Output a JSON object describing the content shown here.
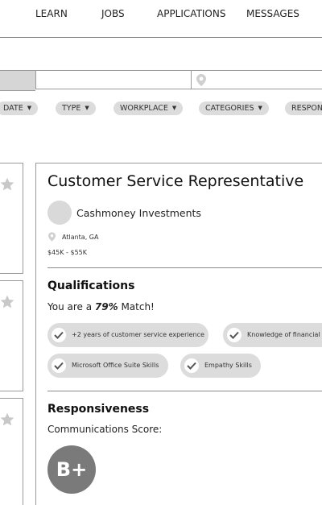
{
  "nav": {
    "items": [
      {
        "label": "LEARN"
      },
      {
        "label": "JOBS"
      },
      {
        "label": "APPLICATIONS"
      },
      {
        "label": "MESSAGES"
      }
    ]
  },
  "search": {
    "query_placeholder": "",
    "location_placeholder": ""
  },
  "filters": [
    {
      "label": "DATE"
    },
    {
      "label": "TYPE"
    },
    {
      "label": "WORKPLACE"
    },
    {
      "label": "CATEGORIES"
    },
    {
      "label": "RESPON"
    }
  ],
  "job": {
    "title": "Customer Service Representative",
    "company": "Cashmoney Investments",
    "location": "Atlanta, GA",
    "salary": "$45K - $55K"
  },
  "qualifications": {
    "title": "Qualifications",
    "match_prefix": "You are a ",
    "match_value": "79%",
    "match_suffix": " Match!",
    "skills": [
      {
        "label": "+2 years of customer service experience"
      },
      {
        "label": "Knowledge of financial m"
      },
      {
        "label": "Microsoft Office Suite Skills"
      },
      {
        "label": "Empathy Skills"
      }
    ]
  },
  "responsiveness": {
    "title": "Responsiveness",
    "label": "Communications Score:",
    "grade": "B+"
  },
  "colors": {
    "pill_bg": "#dcdcdc",
    "grade_bg": "#7a7a7a",
    "divider": "#8a8a8a"
  },
  "icons": {
    "location": "location-pin-icon",
    "star": "star-icon",
    "check": "check-icon"
  }
}
